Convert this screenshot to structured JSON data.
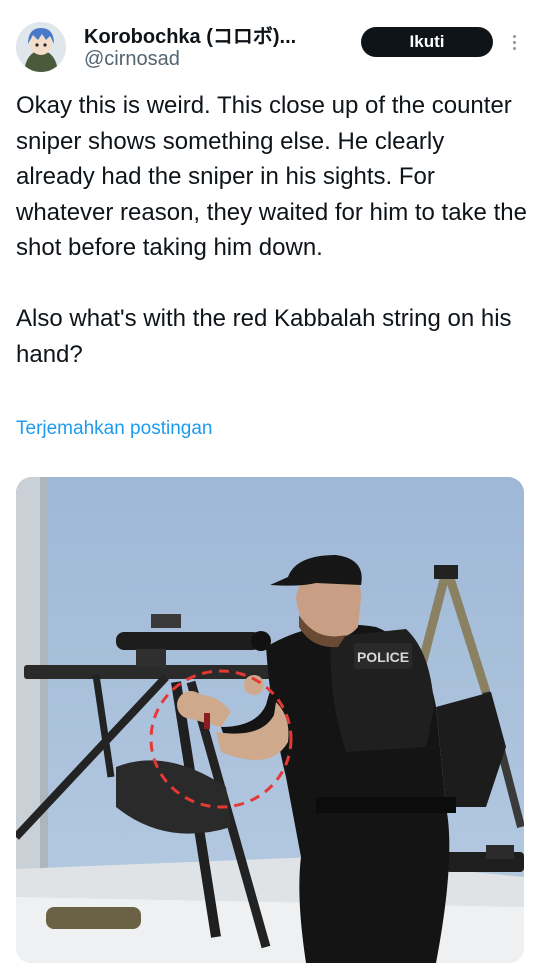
{
  "author": {
    "display_name": "Korobochka (コロボ)...",
    "handle": "@cirnosad"
  },
  "actions": {
    "follow_label": "Ikuti"
  },
  "tweet": {
    "paragraphs": [
      "Okay this is weird. This close up of the counter sniper shows something else. He clearly already had the sniper in his sights. For whatever reason, they waited for him to take the shot before taking him down.",
      "Also what's with the red Kabbalah string on his hand?"
    ],
    "translate_label": "Terjemahkan postingan"
  },
  "media": {
    "vest_label": "POLICE"
  },
  "colors": {
    "follow_bg": "#0f1419",
    "link": "#1d9bf0",
    "annotation_circle": "#e53935",
    "sky": "#a9c1dd"
  },
  "icons": {
    "more": "more-vertical-icon"
  }
}
